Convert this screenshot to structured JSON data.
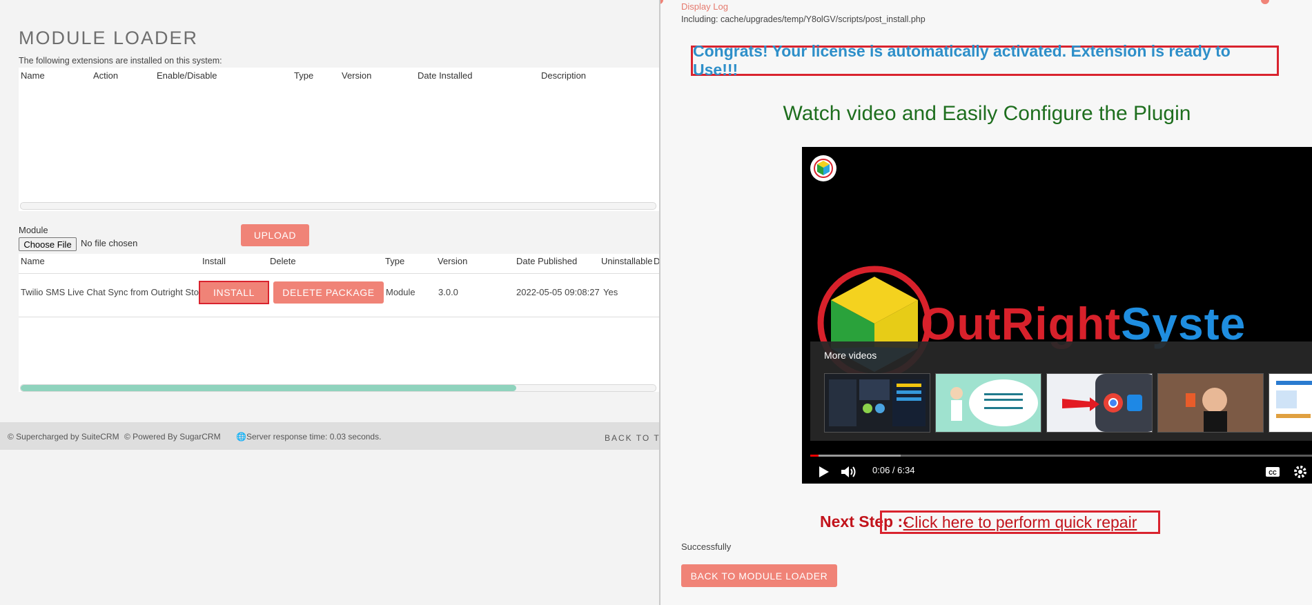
{
  "module_loader": {
    "title": "MODULE LOADER",
    "installed_caption": "The following extensions are installed on this system:",
    "installed_columns": [
      "Name",
      "Action",
      "Enable/Disable",
      "Type",
      "Version",
      "Date Installed",
      "Description"
    ],
    "module_label": "Module",
    "choose_file": "Choose File",
    "no_file": "No file chosen",
    "upload": "UPLOAD",
    "package_columns": [
      "Name",
      "Install",
      "Delete",
      "Type",
      "Version",
      "Date Published",
      "Uninstallable",
      "D"
    ],
    "package": {
      "name": "Twilio SMS Live Chat Sync from Outright Store",
      "install": "INSTALL",
      "delete": "DELETE PACKAGE",
      "type": "Module",
      "version": "3.0.0",
      "date_published": "2022-05-05 09:08:27",
      "uninstallable": "Yes"
    },
    "package_scroll_fraction": 0.78
  },
  "footer": {
    "supercharged": "© Supercharged by SuiteCRM",
    "powered": "© Powered By SugarCRM",
    "server_time": "Server response time: 0.03 seconds.",
    "back_to_top": "BACK TO TO"
  },
  "modal": {
    "log_link": "Display Log",
    "including": "Including: cache/upgrades/temp/Y8olGV/scripts/post_install.php",
    "congrats": "Congrats! Your license is automatically activated. Extension is ready to Use!!!",
    "watch_title": "Watch video and Easily Configure the Plugin",
    "video": {
      "brand_part1": "OutRight",
      "brand_part2": "Syste",
      "more_videos": "More videos",
      "time": "0:06 / 6:34",
      "played_fraction": 0.016,
      "thumbnails": [
        "dashboard-thumbnail",
        "cartoon-speech-thumbnail",
        "chrome-phone-thumbnail",
        "person-selfie-thumbnail",
        "slides-thumbnail"
      ]
    },
    "next_step_label": "Next Step :-",
    "repair_link": "Click here to perform quick repair",
    "success": "Successfully",
    "back_button": "BACK TO MODULE LOADER"
  },
  "colors": {
    "accent_salmon": "#f08377",
    "highlight_red": "#d9232e",
    "congrats_blue": "#2e8fc9",
    "title_green": "#1e6e1e",
    "brand_red": "#d8212b",
    "brand_blue": "#1f8ee0",
    "scroll_teal": "#8fd3bd"
  }
}
